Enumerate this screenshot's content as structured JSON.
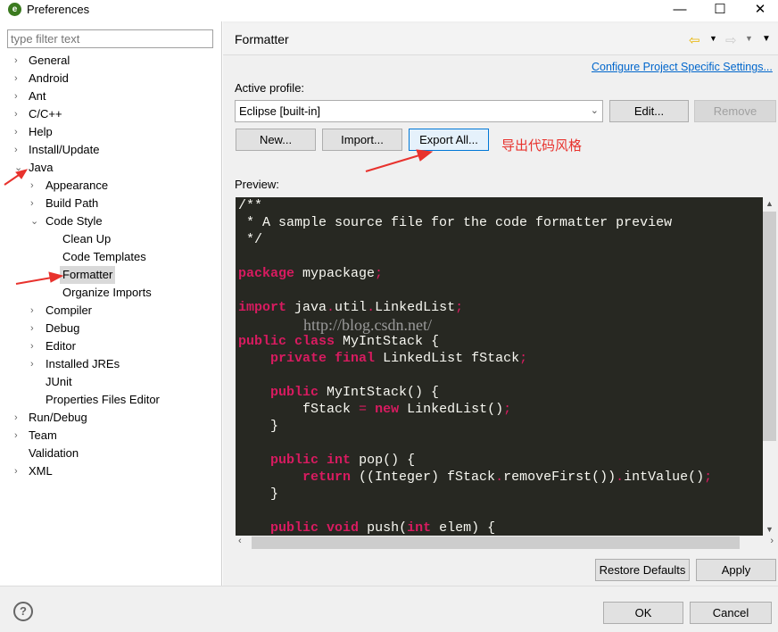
{
  "window": {
    "title": "Preferences",
    "minimize": "—",
    "maximize": "☐",
    "close": "✕"
  },
  "filter": {
    "placeholder": "type filter text"
  },
  "tree": [
    {
      "label": "General",
      "level": 0,
      "arrow": "›"
    },
    {
      "label": "Android",
      "level": 0,
      "arrow": "›"
    },
    {
      "label": "Ant",
      "level": 0,
      "arrow": "›"
    },
    {
      "label": "C/C++",
      "level": 0,
      "arrow": "›"
    },
    {
      "label": "Help",
      "level": 0,
      "arrow": "›"
    },
    {
      "label": "Install/Update",
      "level": 0,
      "arrow": "›"
    },
    {
      "label": "Java",
      "level": 0,
      "arrow": "⌄"
    },
    {
      "label": "Appearance",
      "level": 1,
      "arrow": "›"
    },
    {
      "label": "Build Path",
      "level": 1,
      "arrow": "›"
    },
    {
      "label": "Code Style",
      "level": 1,
      "arrow": "⌄"
    },
    {
      "label": "Clean Up",
      "level": 2,
      "arrow": ""
    },
    {
      "label": "Code Templates",
      "level": 2,
      "arrow": ""
    },
    {
      "label": "Formatter",
      "level": 2,
      "arrow": "",
      "selected": true
    },
    {
      "label": "Organize Imports",
      "level": 2,
      "arrow": ""
    },
    {
      "label": "Compiler",
      "level": 1,
      "arrow": "›"
    },
    {
      "label": "Debug",
      "level": 1,
      "arrow": "›"
    },
    {
      "label": "Editor",
      "level": 1,
      "arrow": "›"
    },
    {
      "label": "Installed JREs",
      "level": 1,
      "arrow": "›"
    },
    {
      "label": "JUnit",
      "level": 1,
      "arrow": ""
    },
    {
      "label": "Properties Files Editor",
      "level": 1,
      "arrow": ""
    },
    {
      "label": "Run/Debug",
      "level": 0,
      "arrow": "›"
    },
    {
      "label": "Team",
      "level": 0,
      "arrow": "›"
    },
    {
      "label": "Validation",
      "level": 0,
      "arrow": ""
    },
    {
      "label": "XML",
      "level": 0,
      "arrow": "›"
    }
  ],
  "page": {
    "title": "Formatter",
    "configure_link": "Configure Project Specific Settings...",
    "active_profile_label": "Active profile:",
    "profile_value": "Eclipse [built-in]",
    "edit": "Edit...",
    "remove": "Remove",
    "new": "New...",
    "import": "Import...",
    "export": "Export All...",
    "preview_label": "Preview:",
    "restore_defaults": "Restore Defaults",
    "apply": "Apply"
  },
  "annotation": {
    "text": "导出代码风格",
    "watermark": "http://blog.csdn.net/",
    "color": "#e8322d"
  },
  "code": [
    [
      [
        "t",
        "/**"
      ]
    ],
    [
      [
        "t",
        " * A sample source file for the code formatter preview"
      ]
    ],
    [
      [
        "t",
        " */"
      ]
    ],
    [],
    [
      [
        "k",
        "package"
      ],
      [
        "t",
        " mypackage"
      ],
      [
        "p",
        ";"
      ]
    ],
    [],
    [
      [
        "k",
        "import"
      ],
      [
        "t",
        " java"
      ],
      [
        "p",
        "."
      ],
      [
        "t",
        "util"
      ],
      [
        "p",
        "."
      ],
      [
        "t",
        "LinkedList"
      ],
      [
        "p",
        ";"
      ]
    ],
    [],
    [
      [
        "k",
        "public"
      ],
      [
        "t",
        " "
      ],
      [
        "k",
        "class"
      ],
      [
        "t",
        " MyIntStack {"
      ]
    ],
    [
      [
        "t",
        "    "
      ],
      [
        "k",
        "private"
      ],
      [
        "t",
        " "
      ],
      [
        "k",
        "final"
      ],
      [
        "t",
        " LinkedList fStack"
      ],
      [
        "p",
        ";"
      ]
    ],
    [],
    [
      [
        "t",
        "    "
      ],
      [
        "k",
        "public"
      ],
      [
        "t",
        " MyIntStack() {"
      ]
    ],
    [
      [
        "t",
        "        fStack "
      ],
      [
        "p",
        "="
      ],
      [
        "t",
        " "
      ],
      [
        "k",
        "new"
      ],
      [
        "t",
        " LinkedList()"
      ],
      [
        "p",
        ";"
      ]
    ],
    [
      [
        "t",
        "    }"
      ]
    ],
    [],
    [
      [
        "t",
        "    "
      ],
      [
        "k",
        "public"
      ],
      [
        "t",
        " "
      ],
      [
        "k",
        "int"
      ],
      [
        "t",
        " pop() {"
      ]
    ],
    [
      [
        "t",
        "        "
      ],
      [
        "k",
        "return"
      ],
      [
        "t",
        " ((Integer) fStack"
      ],
      [
        "p",
        "."
      ],
      [
        "t",
        "removeFirst())"
      ],
      [
        "p",
        "."
      ],
      [
        "t",
        "intValue()"
      ],
      [
        "p",
        ";"
      ]
    ],
    [
      [
        "t",
        "    }"
      ]
    ],
    [],
    [
      [
        "t",
        "    "
      ],
      [
        "k",
        "public"
      ],
      [
        "t",
        " "
      ],
      [
        "k",
        "void"
      ],
      [
        "t",
        " push("
      ],
      [
        "k",
        "int"
      ],
      [
        "t",
        " elem) {"
      ]
    ]
  ],
  "footer": {
    "ok": "OK",
    "cancel": "Cancel",
    "help_icon": "?"
  }
}
